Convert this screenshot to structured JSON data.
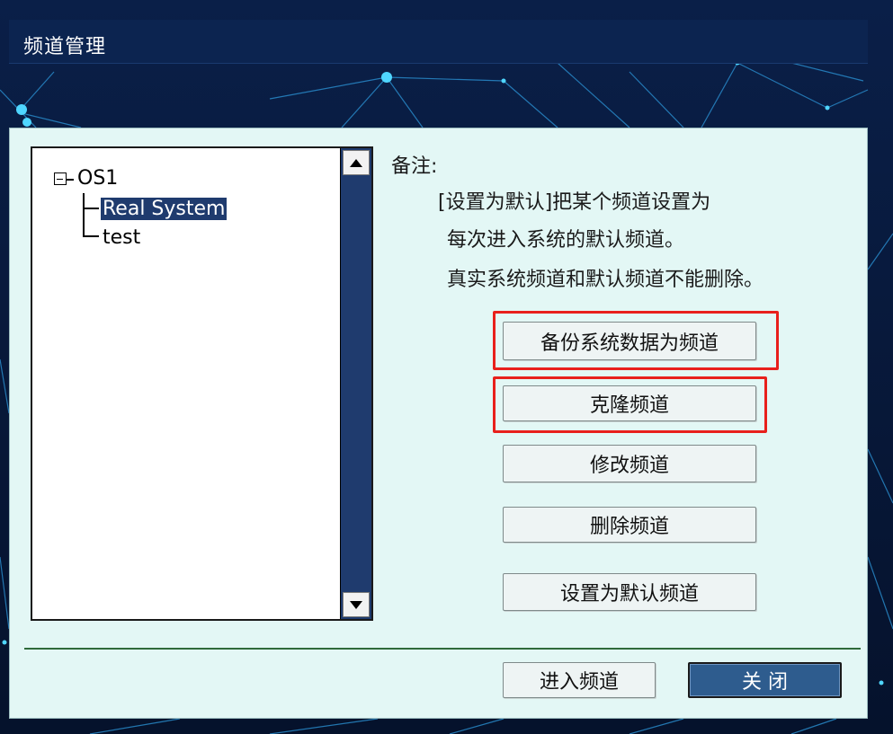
{
  "window": {
    "title": "频道管理"
  },
  "tree": {
    "root": {
      "label": "OS1",
      "expanded": true
    },
    "children": [
      {
        "label": "Real System",
        "selected": true
      },
      {
        "label": "test",
        "selected": false
      }
    ]
  },
  "notes": {
    "title": "备注:",
    "lines": [
      "[设置为默认]把某个频道设置为",
      "每次进入系统的默认频道。",
      "真实系统频道和默认频道不能删除。"
    ]
  },
  "actions": {
    "backup_label": "备份系统数据为频道",
    "clone_label": "克隆频道",
    "modify_label": "修改频道",
    "delete_label": "删除频道",
    "set_default_label": "设置为默认频道"
  },
  "footer": {
    "enter_label": "进入频道",
    "close_label": "关 闭"
  },
  "colors": {
    "background": "#081a3c",
    "titlebar": "#0c2450",
    "dialog": "#e3f7f5",
    "selection": "#1f3b6e",
    "scrollbar": "#1f3b6e",
    "primary_button": "#2e5c8e",
    "highlight": "#e8201c",
    "divider": "#2f6a3a"
  }
}
